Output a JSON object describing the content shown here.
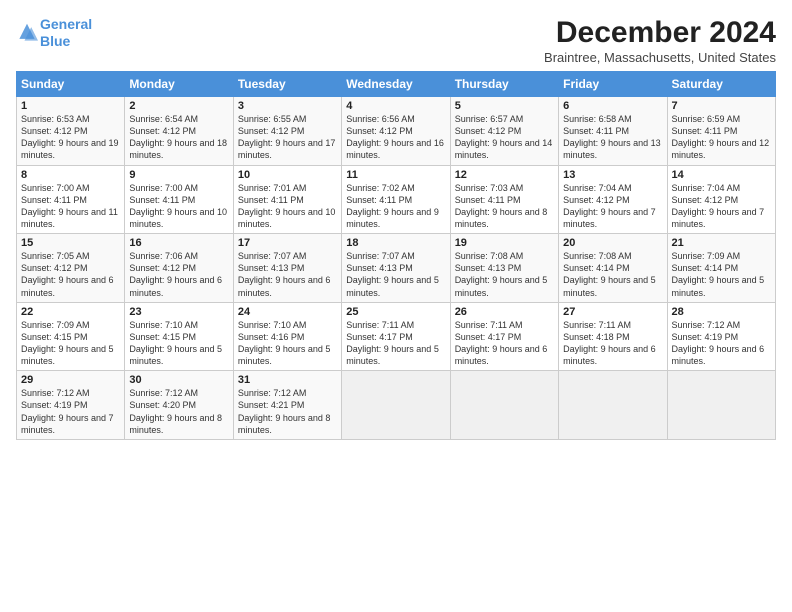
{
  "app": {
    "name_line1": "General",
    "name_line2": "Blue"
  },
  "header": {
    "month_year": "December 2024",
    "location": "Braintree, Massachusetts, United States"
  },
  "calendar": {
    "days_of_week": [
      "Sunday",
      "Monday",
      "Tuesday",
      "Wednesday",
      "Thursday",
      "Friday",
      "Saturday"
    ],
    "weeks": [
      [
        {
          "day": "",
          "empty": true
        },
        {
          "day": "",
          "empty": true
        },
        {
          "day": "",
          "empty": true
        },
        {
          "day": "",
          "empty": true
        },
        {
          "day": "",
          "empty": true
        },
        {
          "day": "",
          "empty": true
        },
        {
          "day": "",
          "empty": true
        }
      ],
      [
        {
          "day": "1",
          "sunrise": "6:53 AM",
          "sunset": "4:12 PM",
          "daylight": "9 hours and 19 minutes."
        },
        {
          "day": "2",
          "sunrise": "6:54 AM",
          "sunset": "4:12 PM",
          "daylight": "9 hours and 18 minutes."
        },
        {
          "day": "3",
          "sunrise": "6:55 AM",
          "sunset": "4:12 PM",
          "daylight": "9 hours and 17 minutes."
        },
        {
          "day": "4",
          "sunrise": "6:56 AM",
          "sunset": "4:12 PM",
          "daylight": "9 hours and 16 minutes."
        },
        {
          "day": "5",
          "sunrise": "6:57 AM",
          "sunset": "4:12 PM",
          "daylight": "9 hours and 14 minutes."
        },
        {
          "day": "6",
          "sunrise": "6:58 AM",
          "sunset": "4:11 PM",
          "daylight": "9 hours and 13 minutes."
        },
        {
          "day": "7",
          "sunrise": "6:59 AM",
          "sunset": "4:11 PM",
          "daylight": "9 hours and 12 minutes."
        }
      ],
      [
        {
          "day": "8",
          "sunrise": "7:00 AM",
          "sunset": "4:11 PM",
          "daylight": "9 hours and 11 minutes."
        },
        {
          "day": "9",
          "sunrise": "7:00 AM",
          "sunset": "4:11 PM",
          "daylight": "9 hours and 10 minutes."
        },
        {
          "day": "10",
          "sunrise": "7:01 AM",
          "sunset": "4:11 PM",
          "daylight": "9 hours and 10 minutes."
        },
        {
          "day": "11",
          "sunrise": "7:02 AM",
          "sunset": "4:11 PM",
          "daylight": "9 hours and 9 minutes."
        },
        {
          "day": "12",
          "sunrise": "7:03 AM",
          "sunset": "4:11 PM",
          "daylight": "9 hours and 8 minutes."
        },
        {
          "day": "13",
          "sunrise": "7:04 AM",
          "sunset": "4:12 PM",
          "daylight": "9 hours and 7 minutes."
        },
        {
          "day": "14",
          "sunrise": "7:04 AM",
          "sunset": "4:12 PM",
          "daylight": "9 hours and 7 minutes."
        }
      ],
      [
        {
          "day": "15",
          "sunrise": "7:05 AM",
          "sunset": "4:12 PM",
          "daylight": "9 hours and 6 minutes."
        },
        {
          "day": "16",
          "sunrise": "7:06 AM",
          "sunset": "4:12 PM",
          "daylight": "9 hours and 6 minutes."
        },
        {
          "day": "17",
          "sunrise": "7:07 AM",
          "sunset": "4:13 PM",
          "daylight": "9 hours and 6 minutes."
        },
        {
          "day": "18",
          "sunrise": "7:07 AM",
          "sunset": "4:13 PM",
          "daylight": "9 hours and 5 minutes."
        },
        {
          "day": "19",
          "sunrise": "7:08 AM",
          "sunset": "4:13 PM",
          "daylight": "9 hours and 5 minutes."
        },
        {
          "day": "20",
          "sunrise": "7:08 AM",
          "sunset": "4:14 PM",
          "daylight": "9 hours and 5 minutes."
        },
        {
          "day": "21",
          "sunrise": "7:09 AM",
          "sunset": "4:14 PM",
          "daylight": "9 hours and 5 minutes."
        }
      ],
      [
        {
          "day": "22",
          "sunrise": "7:09 AM",
          "sunset": "4:15 PM",
          "daylight": "9 hours and 5 minutes."
        },
        {
          "day": "23",
          "sunrise": "7:10 AM",
          "sunset": "4:15 PM",
          "daylight": "9 hours and 5 minutes."
        },
        {
          "day": "24",
          "sunrise": "7:10 AM",
          "sunset": "4:16 PM",
          "daylight": "9 hours and 5 minutes."
        },
        {
          "day": "25",
          "sunrise": "7:11 AM",
          "sunset": "4:17 PM",
          "daylight": "9 hours and 5 minutes."
        },
        {
          "day": "26",
          "sunrise": "7:11 AM",
          "sunset": "4:17 PM",
          "daylight": "9 hours and 6 minutes."
        },
        {
          "day": "27",
          "sunrise": "7:11 AM",
          "sunset": "4:18 PM",
          "daylight": "9 hours and 6 minutes."
        },
        {
          "day": "28",
          "sunrise": "7:12 AM",
          "sunset": "4:19 PM",
          "daylight": "9 hours and 6 minutes."
        }
      ],
      [
        {
          "day": "29",
          "sunrise": "7:12 AM",
          "sunset": "4:19 PM",
          "daylight": "9 hours and 7 minutes."
        },
        {
          "day": "30",
          "sunrise": "7:12 AM",
          "sunset": "4:20 PM",
          "daylight": "9 hours and 8 minutes."
        },
        {
          "day": "31",
          "sunrise": "7:12 AM",
          "sunset": "4:21 PM",
          "daylight": "9 hours and 8 minutes."
        },
        {
          "day": "",
          "empty": true
        },
        {
          "day": "",
          "empty": true
        },
        {
          "day": "",
          "empty": true
        },
        {
          "day": "",
          "empty": true
        }
      ]
    ]
  }
}
